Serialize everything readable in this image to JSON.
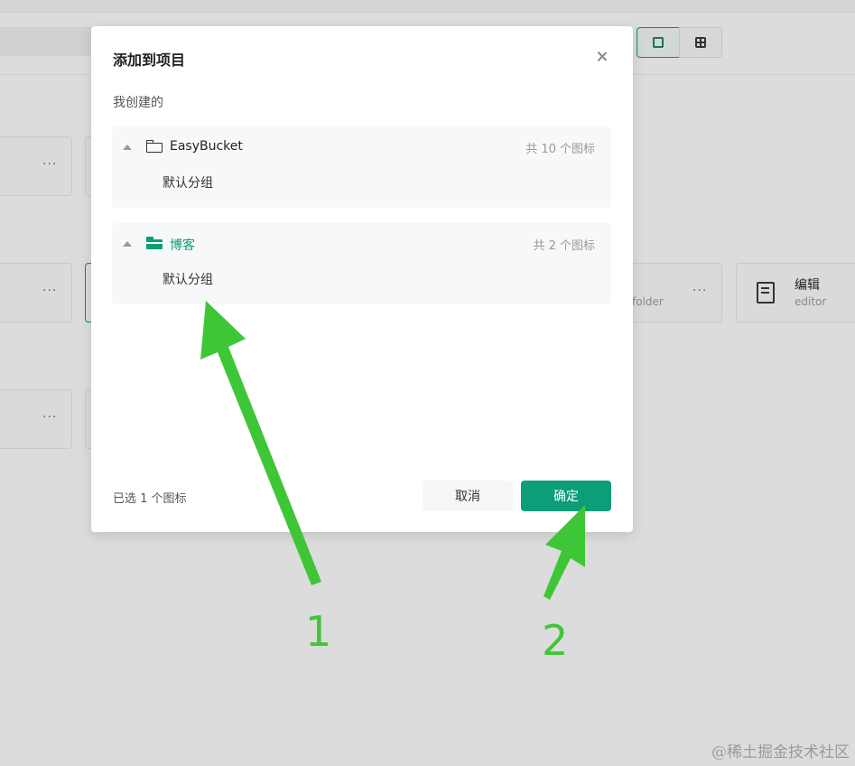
{
  "background": {
    "folder_label": "folder",
    "editor_card": {
      "title": "编辑",
      "subtitle": "editor"
    },
    "card_more_label": "···",
    "watermark": "@稀土掘金技术社区"
  },
  "modal": {
    "title": "添加到项目",
    "section_label": "我创建的",
    "projects": [
      {
        "name": "EasyBucket",
        "count_text": "共 10 个图标",
        "group": "默认分组",
        "selected": false
      },
      {
        "name": "博客",
        "count_text": "共 2 个图标",
        "group": "默认分组",
        "selected": true
      }
    ],
    "selected_count": "已选 1 个图标",
    "cancel_label": "取消",
    "confirm_label": "确定"
  },
  "annotations": {
    "arrow_1_label": "1",
    "arrow_2_label": "2",
    "color": "#3fc637"
  },
  "colors": {
    "accent": "#0b9e78"
  }
}
